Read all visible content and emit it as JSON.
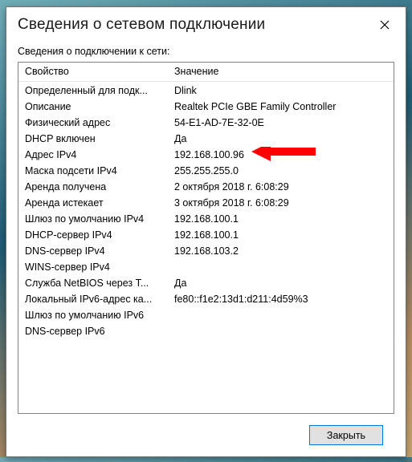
{
  "window": {
    "title": "Сведения о сетевом подключении",
    "subheading": "Сведения о подключении к сети:"
  },
  "table": {
    "headers": {
      "property": "Свойство",
      "value": "Значение"
    },
    "rows": [
      {
        "prop": "Определенный для подк...",
        "val": "Dlink"
      },
      {
        "prop": "Описание",
        "val": "Realtek PCIe GBE Family Controller"
      },
      {
        "prop": "Физический адрес",
        "val": "54-E1-AD-7E-32-0E"
      },
      {
        "prop": "DHCP включен",
        "val": "Да"
      },
      {
        "prop": "Адрес IPv4",
        "val": "192.168.100.96",
        "highlight": true
      },
      {
        "prop": "Маска подсети IPv4",
        "val": "255.255.255.0"
      },
      {
        "prop": "Аренда получена",
        "val": "2 октября 2018 г. 6:08:29"
      },
      {
        "prop": "Аренда истекает",
        "val": "3 октября 2018 г. 6:08:29"
      },
      {
        "prop": "Шлюз по умолчанию IPv4",
        "val": "192.168.100.1"
      },
      {
        "prop": "DHCP-сервер IPv4",
        "val": "192.168.100.1"
      },
      {
        "prop": "DNS-сервер IPv4",
        "val": "192.168.103.2"
      },
      {
        "prop": "WINS-сервер IPv4",
        "val": ""
      },
      {
        "prop": "Служба NetBIOS через T...",
        "val": "Да"
      },
      {
        "prop": "Локальный IPv6-адрес ка...",
        "val": "fe80::f1e2:13d1:d211:4d59%3"
      },
      {
        "prop": "Шлюз по умолчанию IPv6",
        "val": ""
      },
      {
        "prop": "DNS-сервер IPv6",
        "val": ""
      }
    ]
  },
  "buttons": {
    "close": "Закрыть"
  }
}
